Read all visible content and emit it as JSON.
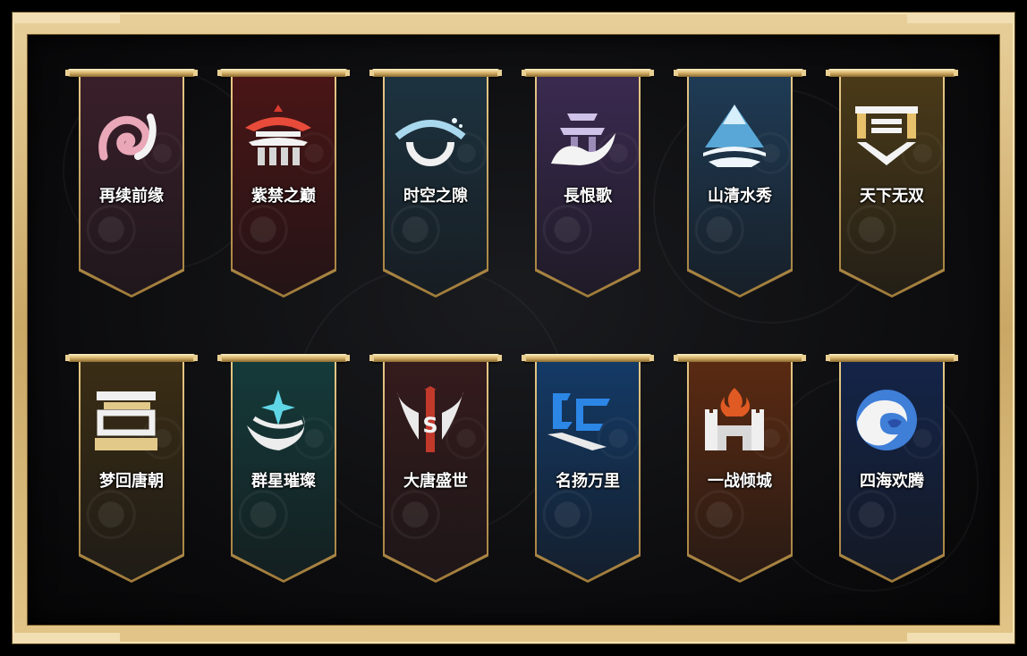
{
  "banners": [
    {
      "label": "再续前缘",
      "icon": "swirl-emblem-icon",
      "color": "#3a1f2a"
    },
    {
      "label": "紫禁之巅",
      "icon": "pagoda-emblem-icon",
      "color": "#4a1516"
    },
    {
      "label": "时空之隙",
      "icon": "ring-portal-emblem-icon",
      "color": "#1d3340"
    },
    {
      "label": "長恨歌",
      "icon": "palace-wave-emblem-icon",
      "color": "#3a2a50"
    },
    {
      "label": "山清水秀",
      "icon": "mountain-water-emblem-icon",
      "color": "#1f3b55"
    },
    {
      "label": "天下无双",
      "icon": "crest-emblem-icon",
      "color": "#4a3a18"
    },
    {
      "label": "梦回唐朝",
      "icon": "tang-glyph-emblem-icon",
      "color": "#3a2d15"
    },
    {
      "label": "群星璀璨",
      "icon": "star-swirl-emblem-icon",
      "color": "#153a3a"
    },
    {
      "label": "大唐盛世",
      "icon": "sword-emblem-icon",
      "color": "#351b1c"
    },
    {
      "label": "名扬万里",
      "icon": "blue-glyph-emblem-icon",
      "color": "#143a66"
    },
    {
      "label": "一战倾城",
      "icon": "fortress-flame-emblem-icon",
      "color": "#5a2a12"
    },
    {
      "label": "四海欢腾",
      "icon": "wave-orb-emblem-icon",
      "color": "#142448"
    }
  ]
}
